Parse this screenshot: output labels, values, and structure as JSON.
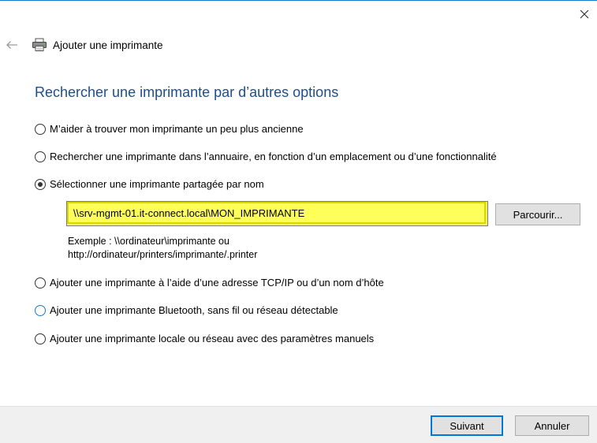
{
  "window": {
    "accent_color": "#1979ca"
  },
  "header": {
    "title": "Ajouter une imprimante"
  },
  "main": {
    "heading": "Rechercher une imprimante par d’autres options",
    "heading_color": "#1e4e8c",
    "options": [
      {
        "label": "M’aider à trouver mon imprimante un peu plus ancienne",
        "checked": false
      },
      {
        "label": "Rechercher une imprimante dans l’annuaire, en fonction d’un emplacement ou d’une fonctionnalité",
        "checked": false
      },
      {
        "label": "Sélectionner une imprimante partagée par nom",
        "checked": true
      },
      {
        "label": "Ajouter une imprimante à l’aide d’une adresse TCP/IP ou d’un nom d’hôte",
        "checked": false
      },
      {
        "label": "Ajouter une imprimante Bluetooth, sans fil ou réseau détectable",
        "checked": false,
        "focused": true
      },
      {
        "label": "Ajouter une imprimante locale ou réseau avec des paramètres manuels",
        "checked": false
      }
    ],
    "shared_printer_path": "\\\\srv-mgmt-01.it-connect.local\\MON_IMPRIMANTE",
    "highlight_color": "#ffff5c",
    "browse_label": "Parcourir...",
    "example_line1": "Exemple : \\\\ordinateur\\imprimante ou",
    "example_line2": "http://ordinateur/printers/imprimante/.printer"
  },
  "footer": {
    "next_label": "Suivant",
    "cancel_label": "Annuler"
  }
}
